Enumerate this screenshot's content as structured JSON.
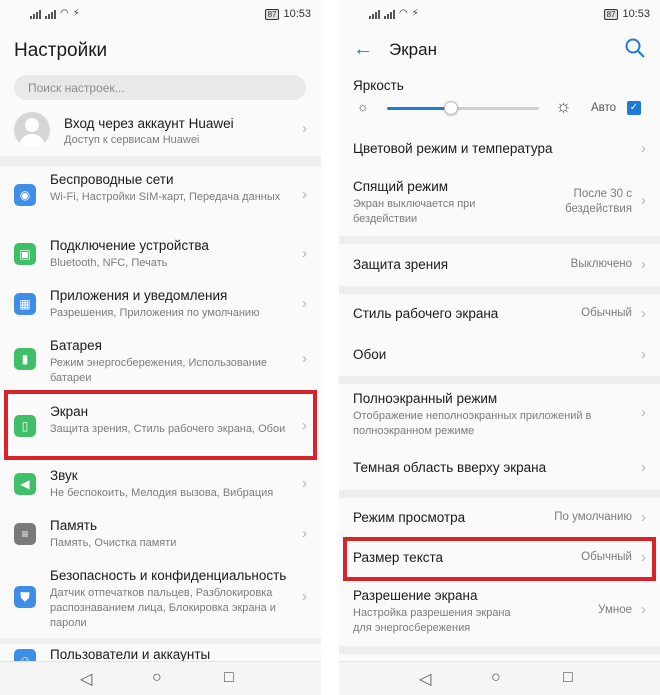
{
  "status": {
    "time": "10:53",
    "battery": "87"
  },
  "left": {
    "title": "Настройки",
    "search_placeholder": "Поиск настроек...",
    "account": {
      "title": "Вход через аккаунт Huawei",
      "subtitle": "Доступ к сервисам Huawei"
    },
    "items": [
      {
        "title": "Беспроводные сети",
        "subtitle": "Wi-Fi, Настройки SIM-карт, Передача данных",
        "icon": "wifi-icon",
        "color": "#3e8ee8"
      },
      {
        "title": "Подключение устройства",
        "subtitle": "Bluetooth, NFC, Печать",
        "icon": "device-connection-icon",
        "color": "#3fbf68"
      },
      {
        "title": "Приложения и уведомления",
        "subtitle": "Разрешения, Приложения по умолчанию",
        "icon": "apps-icon",
        "color": "#3e8ee8"
      },
      {
        "title": "Батарея",
        "subtitle": "Режим энергосбережения, Использование батареи",
        "icon": "battery-icon",
        "color": "#3fbf68"
      },
      {
        "title": "Экран",
        "subtitle": "Защита зрения, Стиль рабочего экрана, Обои",
        "icon": "display-icon",
        "color": "#3fbf68"
      },
      {
        "title": "Звук",
        "subtitle": "Не беспокоить, Мелодия вызова, Вибрация",
        "icon": "sound-icon",
        "color": "#3fbf68"
      },
      {
        "title": "Память",
        "subtitle": "Память, Очистка памяти",
        "icon": "storage-icon",
        "color": "#7a7a7a"
      },
      {
        "title": "Безопасность и конфиденциальность",
        "subtitle": "Датчик отпечатков пальцев, Разблокировка распознаванием лица, Блокировка экрана и пароли",
        "icon": "security-icon",
        "color": "#3e8ee8"
      },
      {
        "title": "Пользователи и аккаунты",
        "subtitle": "",
        "icon": "users-icon",
        "color": "#3e8ee8"
      }
    ]
  },
  "right": {
    "title": "Экран",
    "brightness": {
      "label": "Яркость",
      "auto_label": "Авто",
      "level": 0.42
    },
    "items": [
      {
        "title": "Цветовой режим и температура",
        "subtitle": "",
        "value": ""
      },
      {
        "title": "Спящий режим",
        "subtitle": "Экран выключается при бездействии",
        "value": "После 30 с бездействия"
      },
      {
        "title": "Защита зрения",
        "subtitle": "",
        "value": "Выключено"
      },
      {
        "title": "Стиль рабочего экрана",
        "subtitle": "",
        "value": "Обычный"
      },
      {
        "title": "Обои",
        "subtitle": "",
        "value": ""
      },
      {
        "title": "Полноэкранный режим",
        "subtitle": "Отображение неполноэкранных приложений в полноэкранном режиме",
        "value": ""
      },
      {
        "title": "Темная область вверху экрана",
        "subtitle": "",
        "value": ""
      },
      {
        "title": "Режим просмотра",
        "subtitle": "",
        "value": "По умолчанию"
      },
      {
        "title": "Размер текста",
        "subtitle": "",
        "value": "Обычный"
      },
      {
        "title": "Разрешение экрана",
        "subtitle": "Настройка разрешения экрана для энергосбережения",
        "value": "Умное"
      }
    ]
  },
  "colors": {
    "accent": "#1e7ad9",
    "highlight": "#d9232b"
  }
}
